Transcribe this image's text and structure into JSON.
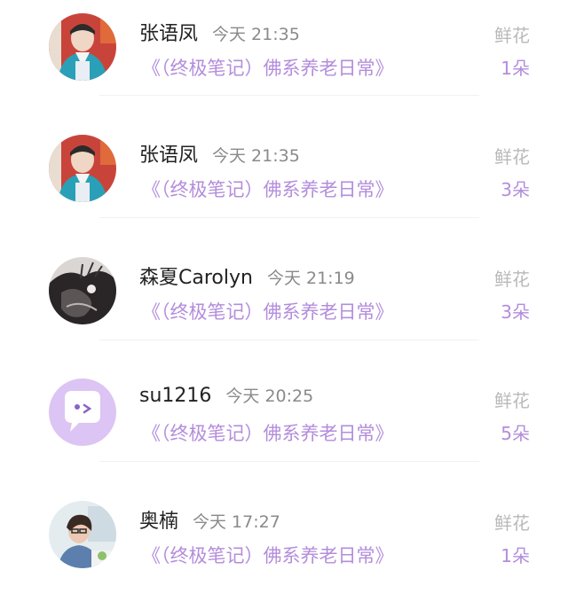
{
  "comments": [
    {
      "name": "张语凤",
      "time": "今天 21:35",
      "book": "《（终极笔记）佛系养老日常》",
      "gift_label": "鲜花",
      "gift_count": "1朵",
      "avatar": "photo-man-blue-jacket"
    },
    {
      "name": "张语凤",
      "time": "今天 21:35",
      "book": "《（终极笔记）佛系养老日常》",
      "gift_label": "鲜花",
      "gift_count": "3朵",
      "avatar": "photo-man-blue-jacket"
    },
    {
      "name": "森夏Carolyn",
      "time": "今天 21:19",
      "book": "《（终极笔记）佛系养老日常》",
      "gift_label": "鲜花",
      "gift_count": "3朵",
      "avatar": "photo-dark-illustration"
    },
    {
      "name": "su1216",
      "time": "今天 20:25",
      "book": "《（终极笔记）佛系养老日常》",
      "gift_label": "鲜花",
      "gift_count": "5朵",
      "avatar": "default-chat-bubble-avatar"
    },
    {
      "name": "奥楠",
      "time": "今天 17:27",
      "book": "《（终极笔记）佛系养老日常》",
      "gift_label": "鲜花",
      "gift_count": "1朵",
      "avatar": "photo-woman-glasses"
    }
  ],
  "colors": {
    "accent": "#b38ddc",
    "name_text": "#222222",
    "time_text": "#8a8a8a",
    "label_text": "#b9b9b9",
    "divider": "#f1f1f1",
    "default_avatar_bg": "#dcc4f4"
  }
}
